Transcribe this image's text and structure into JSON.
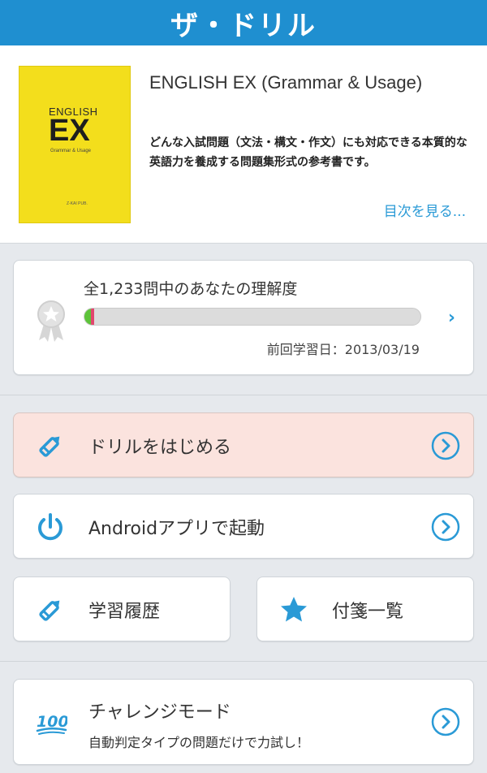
{
  "header": {
    "title": "ザ・ドリル"
  },
  "book": {
    "cover": {
      "word": "ENGLISH",
      "big": "EX",
      "subtitle": "Grammar & Usage",
      "publisher": "Z-KAI PUB."
    },
    "title": "ENGLISH EX (Grammar & Usage)",
    "description": "どんな入試問題（文法・構文・作文）にも対応できる本質的な英語力を養成する問題集形式の参考書です。",
    "toc_link": "目次を見る..."
  },
  "progress": {
    "label": "全1,233問中のあなたの理解度",
    "correct_fraction": 0.02,
    "wrong_fraction": 0.008,
    "last_study": "前回学習日：2013/03/19",
    "colors": {
      "correct": "#5dc33a",
      "wrong": "#e2466e",
      "track": "#dcdcdc"
    }
  },
  "menu": {
    "start_drill": "ドリルをはじめる",
    "launch_android": "Androidアプリで起動",
    "history": "学習履歴",
    "bookmarks": "付箋一覧",
    "challenge": {
      "title": "チャレンジモード",
      "subtitle": "自動判定タイプの問題だけで力試し！"
    }
  },
  "icons": {
    "medal": "medal-icon",
    "pencil": "pencil-icon",
    "power": "power-icon",
    "star": "star-icon",
    "hundred": "hundred-icon",
    "arrow": "arrow-circle-icon"
  },
  "theme": {
    "accent": "#1f8fd0",
    "link": "#2a9ad6",
    "highlight_bg": "#fbe3de"
  }
}
